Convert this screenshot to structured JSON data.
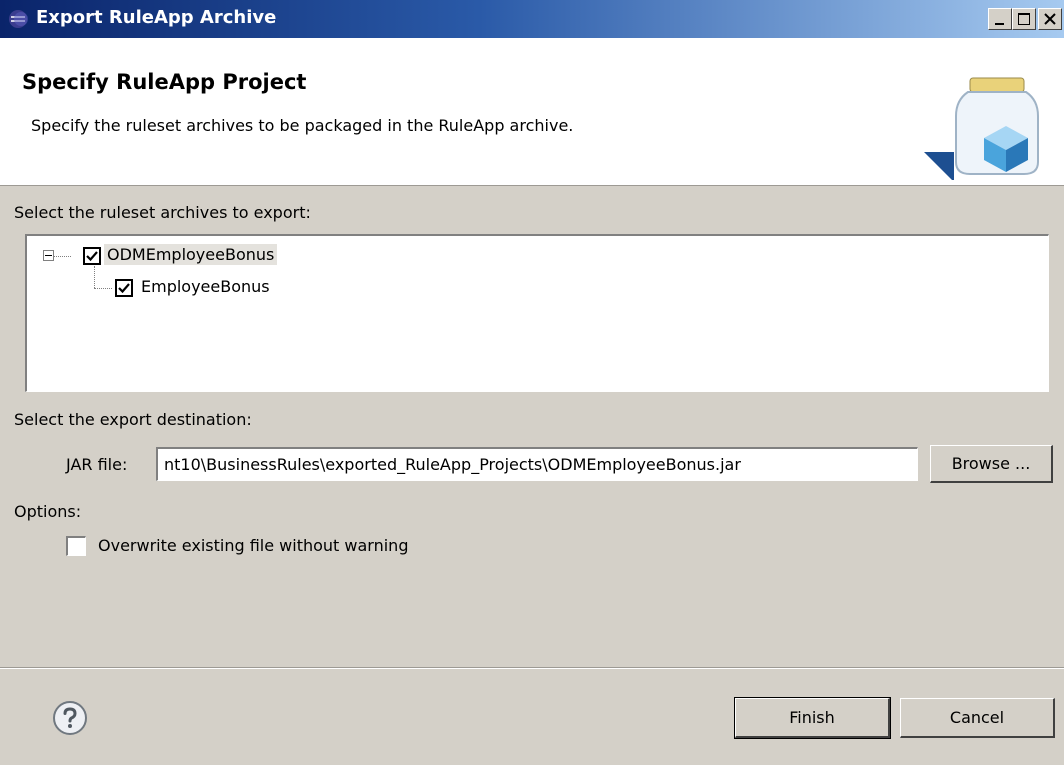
{
  "window": {
    "title": "Export RuleApp Archive"
  },
  "header": {
    "title": "Specify RuleApp Project",
    "description": "Specify the ruleset archives to be packaged in the RuleApp archive.",
    "image_icon": "jar-with-cube-icon"
  },
  "rulesets": {
    "label": "Select the ruleset archives to export:",
    "tree": [
      {
        "label": "ODMEmployeeBonus",
        "checked": true,
        "expanded": true
      },
      {
        "label": "EmployeeBonus",
        "checked": true
      }
    ]
  },
  "destination": {
    "label": "Select the export destination:",
    "jar_label": "JAR file:",
    "jar_value": "nt10\\BusinessRules\\exported_RuleApp_Projects\\ODMEmployeeBonus.jar",
    "browse_label": "Browse ..."
  },
  "options": {
    "label": "Options:",
    "overwrite_label": "Overwrite existing file without warning",
    "overwrite_checked": false
  },
  "footer": {
    "help_icon": "help-icon",
    "finish_label": "Finish",
    "cancel_label": "Cancel"
  }
}
